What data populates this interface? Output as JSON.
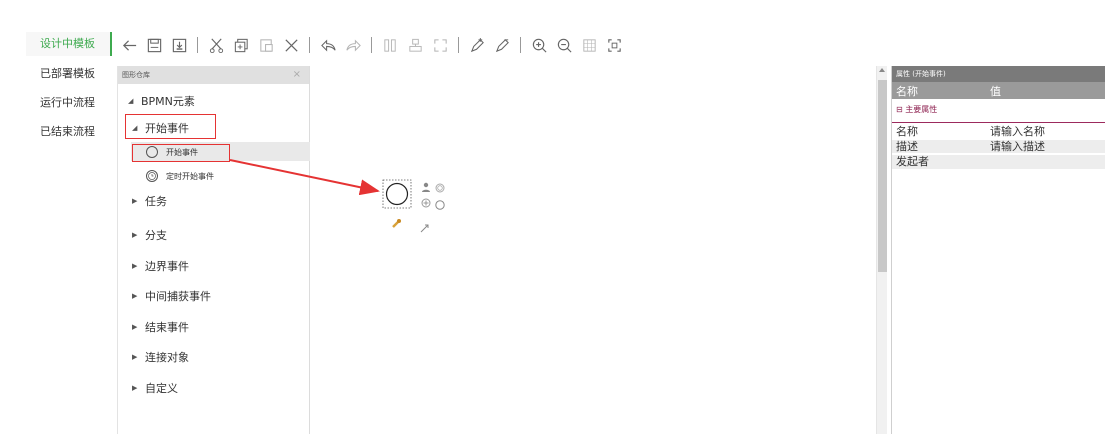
{
  "nav": {
    "items": [
      {
        "label": "设计中模板",
        "active": true
      },
      {
        "label": "已部署模板",
        "active": false
      },
      {
        "label": "运行中流程",
        "active": false
      },
      {
        "label": "已结束流程",
        "active": false
      }
    ]
  },
  "toolbar": {
    "icons": [
      "arrow-left-icon",
      "save-icon",
      "import-icon",
      "cut-icon",
      "copy-icon",
      "paste-icon",
      "delete-icon",
      "undo-icon",
      "redo-icon",
      "align-icon",
      "group-icon",
      "fit-icon",
      "edit-marker-icon",
      "edit-marker-alt-icon",
      "zoom-in-icon",
      "zoom-out-icon",
      "grid-icon",
      "fullscreen-icon"
    ]
  },
  "palette": {
    "title": "图形仓库",
    "close": "×",
    "root_label": "BPMN元素",
    "start_event_group": "开始事件",
    "start_event_item": "开始事件",
    "timer_start_item": "定时开始事件",
    "groups": [
      "任务",
      "分支",
      "边界事件",
      "中间捕获事件",
      "结束事件",
      "连接对象",
      "自定义"
    ]
  },
  "properties": {
    "title": "属性 (开始事件)",
    "col_name": "名称",
    "col_value": "值",
    "group": "主要属性",
    "rows": [
      {
        "name": "名称",
        "value": "请输入名称"
      },
      {
        "name": "描述",
        "value": "请输入描述"
      },
      {
        "name": "发起者",
        "value": ""
      }
    ]
  },
  "colors": {
    "accent": "#3eaa4f",
    "highlight": "#e53333",
    "group_color": "#8e2150"
  }
}
